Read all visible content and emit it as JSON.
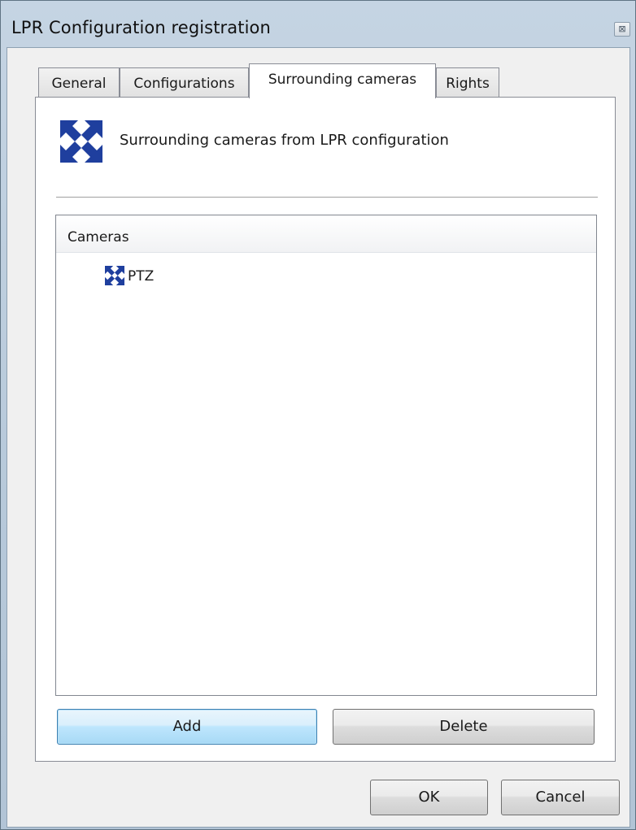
{
  "window": {
    "title": "LPR Configuration registration",
    "close_glyph": "⊠"
  },
  "tabs": [
    {
      "label": "General",
      "active": false
    },
    {
      "label": "Configurations",
      "active": false
    },
    {
      "label": "Surrounding cameras",
      "active": true
    },
    {
      "label": "Rights",
      "active": false
    }
  ],
  "panel": {
    "header_icon": "camera-move-arrows-icon",
    "header_text": "Surrounding cameras from LPR configuration",
    "list": {
      "column_header": "Cameras",
      "items": [
        {
          "icon": "ptz-camera-icon",
          "label": "PTZ"
        }
      ]
    },
    "add_label": "Add",
    "delete_label": "Delete"
  },
  "footer": {
    "ok_label": "OK",
    "cancel_label": "Cancel"
  },
  "colors": {
    "icon_blue": "#1f3f9e",
    "title_bar": "#b9cadb",
    "default_button": "#bee6fd"
  }
}
